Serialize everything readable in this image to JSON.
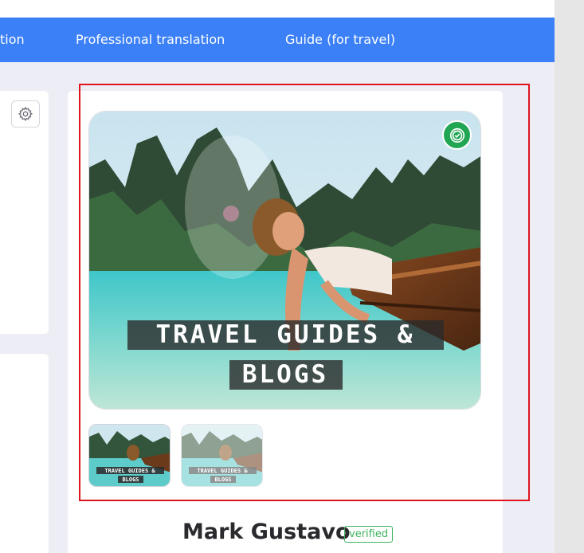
{
  "nav": {
    "items": [
      {
        "label": "tion"
      },
      {
        "label": "Professional translation"
      },
      {
        "label": "Guide (for travel)"
      }
    ]
  },
  "profile": {
    "name": "Mark Gustavo",
    "tag": "verified"
  },
  "gallery": {
    "banner_line1": "TRAVEL GUIDES &",
    "banner_line2": "BLOGS",
    "thumbnails": [
      {
        "line1": "TRAVEL GUIDES &",
        "line2": "BLOGS"
      },
      {
        "line1": "TRAVEL GUIDES &",
        "line2": "BLOGS"
      }
    ]
  },
  "icons": {
    "settings": "gear-icon",
    "verified": "verified-check-icon"
  },
  "colors": {
    "nav_bg": "#3b80f6",
    "verified_green": "#21a653",
    "highlight_red": "#e0141e"
  }
}
